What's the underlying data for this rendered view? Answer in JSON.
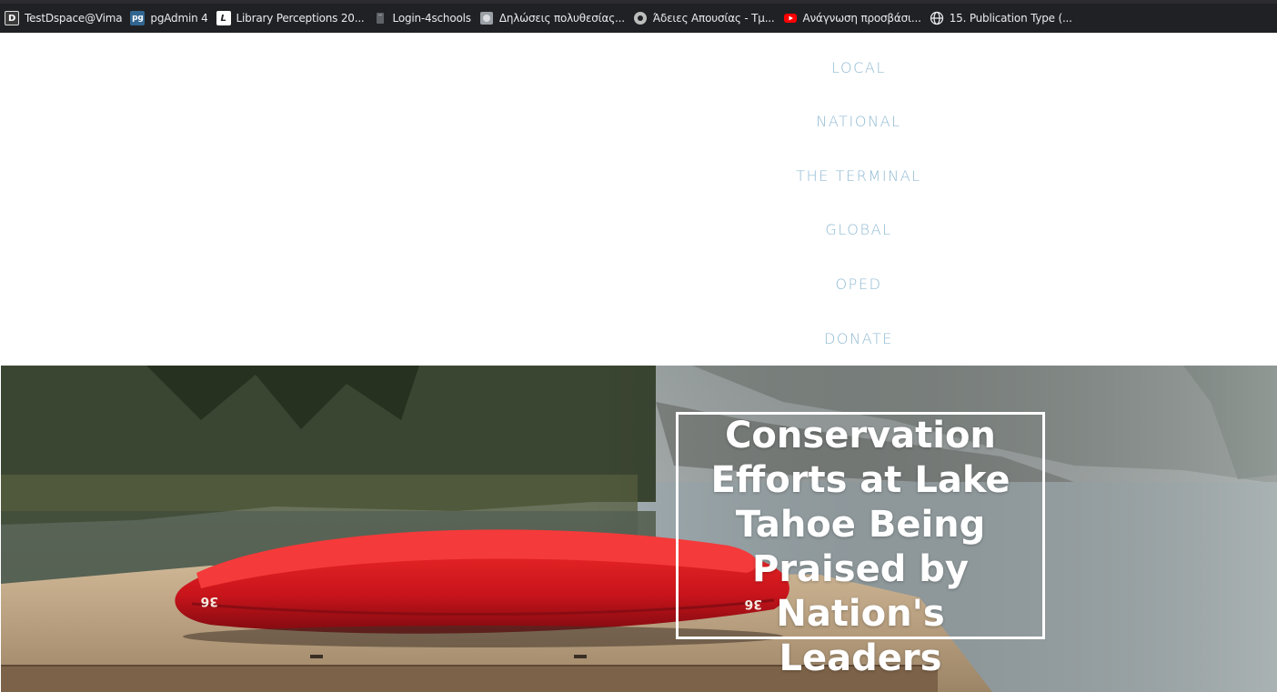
{
  "bookmarks": [
    {
      "label": "TestDspace@Vima",
      "icon": "dspace-icon",
      "color": "#3c3c3c"
    },
    {
      "label": "pgAdmin 4",
      "icon": "pgadmin-icon",
      "color": "#326690"
    },
    {
      "label": "Library Perceptions 20...",
      "icon": "libqual-icon",
      "color": "#ffffff"
    },
    {
      "label": "Login-4schools",
      "icon": "page-icon",
      "color": "#5f6368"
    },
    {
      "label": "Δηλώσεις πολυθεσίας...",
      "icon": "site-icon",
      "color": "#9aa0a6"
    },
    {
      "label": "Άδειες Απουσίας - Τμ...",
      "icon": "gear-icon",
      "color": "#bdbdbd"
    },
    {
      "label": "Ανάγνωση προσβάσι...",
      "icon": "youtube-icon",
      "color": "#ff0000"
    },
    {
      "label": "15. Publication Type (...",
      "icon": "globe-icon",
      "color": "#e8eaed"
    }
  ],
  "nav": {
    "items": [
      "LOCAL",
      "NATIONAL",
      "THE TERMINAL",
      "GLOBAL",
      "OPED",
      "DONATE"
    ],
    "color": "#8fbad3"
  },
  "hero": {
    "headline": "Conservation Efforts at Lake Tahoe Being Praised by Nation's Leaders",
    "headline_lines": [
      "Conservation",
      "Efforts at Lake",
      "Tahoe Being",
      "Praised by Nation's",
      "Leaders"
    ],
    "canoe_number": "36"
  }
}
